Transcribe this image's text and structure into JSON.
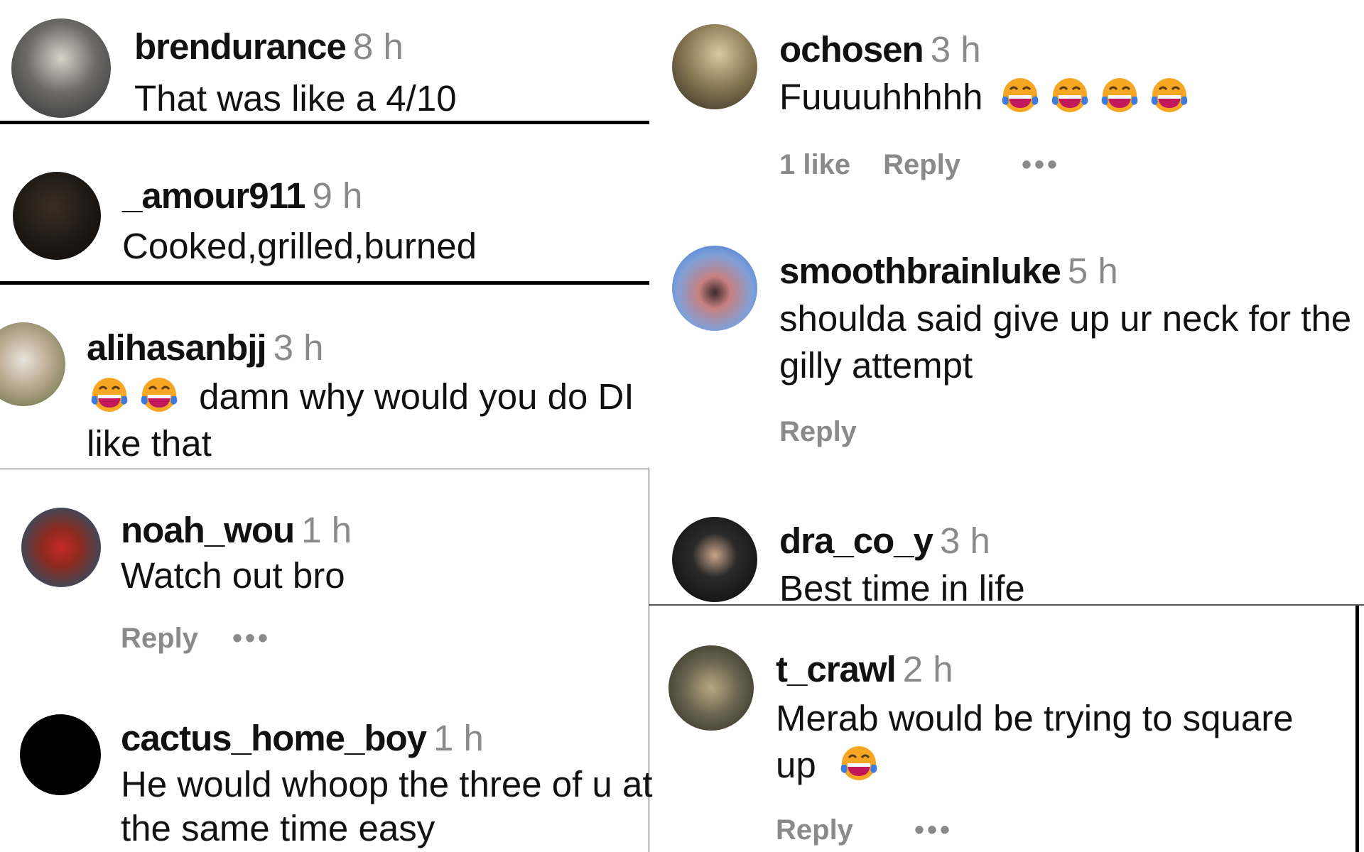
{
  "comments": [
    {
      "user": "brendurance",
      "time": "8 h",
      "text": "That was like a 4/10",
      "avatar_color": "#3a3f45"
    },
    {
      "user": "_amour911",
      "time": "9 h",
      "text": "Cooked,grilled,burned",
      "avatar_color": "#1b1612"
    },
    {
      "user": "alihasanbjj",
      "time": "3 h",
      "text_line1": "damn why would you do DI",
      "text_line2": "like that",
      "emoji_count": 2,
      "avatar_color": "#b9a78e"
    },
    {
      "user": "noah_wou",
      "time": "1 h",
      "text": "Watch out bro",
      "reply": "Reply",
      "more": "•••",
      "avatar_color": "#6b4a3a"
    },
    {
      "user": "cactus_home_boy",
      "time": "1 h",
      "text_line1": "He would whoop the three of u at",
      "text_line2": "the same time easy",
      "avatar_color": "#000000"
    },
    {
      "user": "ochosen",
      "time": "3 h",
      "text": "Fuuuuhhhhh",
      "emoji_count": 4,
      "likes": "1 like",
      "reply": "Reply",
      "more": "•••",
      "avatar_color": "#8a7a55"
    },
    {
      "user": "smoothbrainluke",
      "time": "5 h",
      "text_line1": "shoulda said give up ur neck for the",
      "text_line2": "gilly attempt",
      "reply": "Reply",
      "avatar_color": "#7fa0d8"
    },
    {
      "user": "dra_co_y",
      "time": "3 h",
      "text": "Best time in life",
      "avatar_color": "#161616"
    },
    {
      "user": "t_crawl",
      "time": "2 h",
      "text_line1": "Merab would be trying to square",
      "text_line2": "up",
      "emoji_count": 1,
      "reply": "Reply",
      "more": "•••",
      "avatar_color": "#6a6450"
    }
  ],
  "emoji": {
    "name": "face-with-tears-of-joy",
    "face": "#f5a623",
    "mouth": "#c2185b",
    "tears": "#3d7be0"
  }
}
